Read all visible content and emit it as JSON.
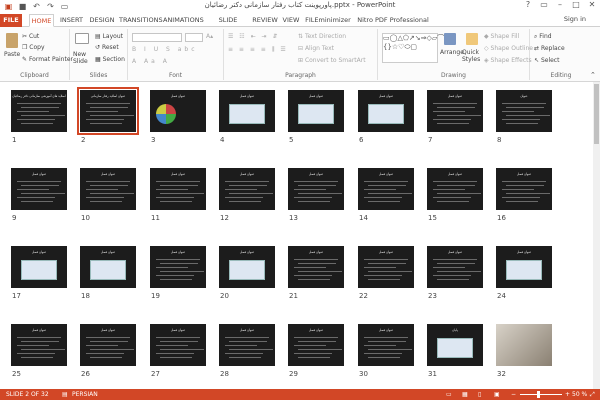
{
  "window": {
    "title": "پاورپوینت کتاب رفتار سازمانی دکتر رضائیان.pptx - PowerPoint"
  },
  "tabs": [
    "FILE",
    "HOME",
    "INSERT",
    "DESIGN",
    "TRANSITIONS",
    "ANIMATIONS",
    "SLIDE SHOW",
    "REVIEW",
    "VIEW",
    "FILEminimizer",
    "Nitro PDF Professional"
  ],
  "user": {
    "signin": "Sign in"
  },
  "ribbon": {
    "clipboard": {
      "label": "Clipboard",
      "paste": "Paste",
      "cut": "Cut",
      "copy": "Copy",
      "format_painter": "Format Painter"
    },
    "slides": {
      "label": "Slides",
      "new_slide": "New Slide",
      "layout": "Layout",
      "reset": "Reset",
      "section": "Section"
    },
    "font": {
      "label": "Font"
    },
    "paragraph": {
      "label": "Paragraph",
      "text_direction": "Text Direction",
      "align_text": "Align Text",
      "convert_smartart": "Convert to SmartArt"
    },
    "drawing": {
      "label": "Drawing",
      "arrange": "Arrange",
      "quick_styles": "Quick Styles",
      "shape_fill": "Shape Fill",
      "shape_outline": "Shape Outline",
      "shape_effects": "Shape Effects"
    },
    "editing": {
      "label": "Editing",
      "find": "Find",
      "replace": "Replace",
      "select": "Select"
    }
  },
  "slides": {
    "selected": 2,
    "titles": [
      "اسلاید های آموزشی سازمانی دکتر رضائیان",
      "عنوان اسلاید رفتار سازمانی",
      "عنوان فصل",
      "عنوان فصل",
      "عنوان فصل",
      "عنوان فصل",
      "عنوان فصل",
      "عنوان",
      "عنوان فصل",
      "عنوان فصل",
      "عنوان فصل",
      "عنوان فصل",
      "عنوان فصل",
      "عنوان فصل",
      "عنوان فصل",
      "عنوان فصل",
      "عنوان فصل",
      "عنوان فصل",
      "عنوان فصل",
      "عنوان فصل",
      "عنوان فصل",
      "عنوان فصل",
      "عنوان فصل",
      "عنوان فصل",
      "عنوان فصل",
      "عنوان فصل",
      "عنوان فصل",
      "عنوان فصل",
      "عنوان فصل",
      "عنوان فصل",
      "پایان",
      ""
    ]
  },
  "status": {
    "slide_of": "SLIDE 2 OF 32",
    "language": "PERSIAN",
    "zoom": "50 %"
  }
}
